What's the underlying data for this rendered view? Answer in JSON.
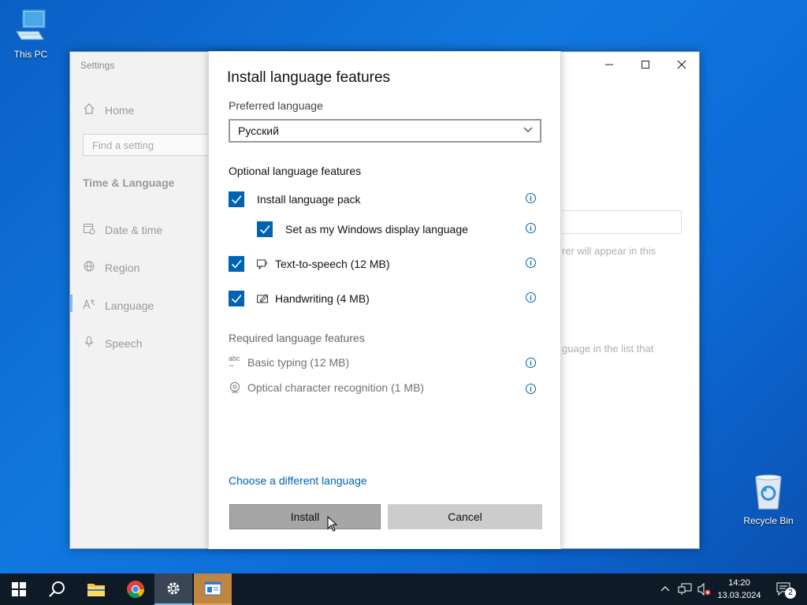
{
  "desktop": {
    "icons": [
      {
        "label": "This PC",
        "icon": "computer-icon"
      },
      {
        "label": "Recycle Bin",
        "icon": "recycle-bin-icon"
      }
    ]
  },
  "settings": {
    "app_title": "Settings",
    "home_label": "Home",
    "search_placeholder": "Find a setting",
    "section_title": "Time & Language",
    "nav": [
      {
        "label": "Date & time",
        "icon": "calendar-clock-icon"
      },
      {
        "label": "Region",
        "icon": "globe-icon"
      },
      {
        "label": "Language",
        "icon": "language-icon",
        "active": true
      },
      {
        "label": "Speech",
        "icon": "microphone-icon"
      }
    ],
    "bg_text_1": "rer will appear in this",
    "bg_text_2": "guage in the list that"
  },
  "dialog": {
    "title": "Install language features",
    "preferred_label": "Preferred language",
    "preferred_value": "Русский",
    "optional_label": "Optional language features",
    "optional": [
      {
        "label": "Install language pack",
        "checked": true,
        "icon": ""
      },
      {
        "label": "Set as my Windows display language",
        "checked": true,
        "icon": ""
      },
      {
        "label": "Text-to-speech (12 MB)",
        "checked": true,
        "icon": "speech-icon"
      },
      {
        "label": "Handwriting (4 MB)",
        "checked": true,
        "icon": "handwriting-icon"
      }
    ],
    "required_label": "Required language features",
    "required": [
      {
        "label": "Basic typing (12 MB)",
        "icon": "abc-typing-icon"
      },
      {
        "label": "Optical character recognition (1 MB)",
        "icon": "ocr-icon"
      }
    ],
    "link": "Choose a different language",
    "install_button": "Install",
    "cancel_button": "Cancel"
  },
  "taskbar": {
    "time": "14:20",
    "date": "13.03.2024",
    "notification_count": "2"
  },
  "colors": {
    "accent": "#0063b1",
    "taskbar": "#0f1a27"
  }
}
